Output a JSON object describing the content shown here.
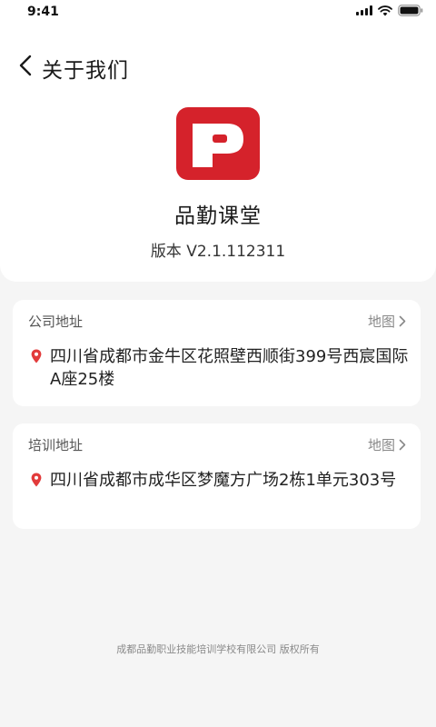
{
  "status_bar": {
    "time": "9:41"
  },
  "header": {
    "title": "关于我们"
  },
  "app": {
    "name": "品勤课堂",
    "version": "版本 V2.1.112311"
  },
  "company_address": {
    "label": "公司地址",
    "map_link": "地图",
    "address": "四川省成都市金牛区花照壁西顺街399号西宸国际A座25楼"
  },
  "training_address": {
    "label": "培训地址",
    "map_link": "地图",
    "address": "四川省成都市成华区梦魔方广场2栋1单元303号"
  },
  "footer": {
    "copyright": "成都品勤职业技能培训学校有限公司 版权所有"
  },
  "colors": {
    "brand": "#d5222b",
    "pin": "#e23b3b",
    "background": "#f5f5f5"
  },
  "icons": [
    "signal-icon",
    "wifi-icon",
    "battery-icon",
    "back-arrow-icon",
    "app-logo",
    "chevron-right-icon",
    "location-pin-icon"
  ]
}
